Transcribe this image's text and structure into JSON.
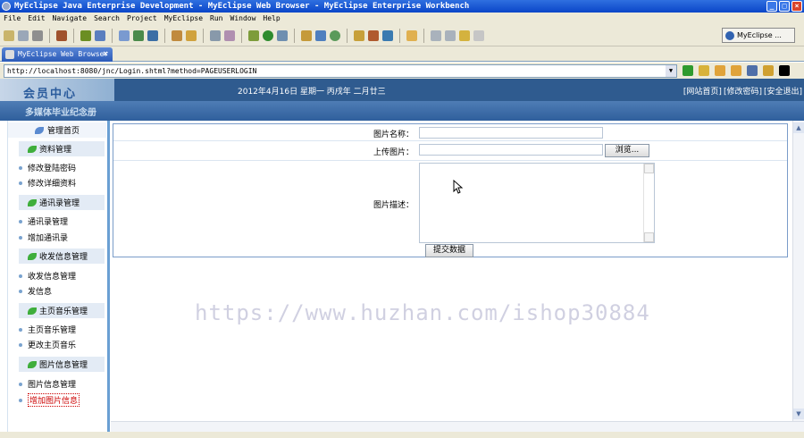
{
  "window": {
    "title": "MyEclipse Java Enterprise Development - MyEclipse Web Browser - MyEclipse Enterprise Workbench"
  },
  "menu": [
    "File",
    "Edit",
    "Navigate",
    "Search",
    "Project",
    "MyEclipse",
    "Run",
    "Window",
    "Help"
  ],
  "perspective": "MyEclipse ...",
  "tab": {
    "label": "MyEclipse Web Browser"
  },
  "address": "http://localhost:8080/jnc/Login.shtml?method=PAGEUSERLOGIN",
  "header": {
    "logo": "会员中心",
    "date": "2012年4月16日 星期一 丙戌年 二月廿三",
    "links": [
      "[网站首页]",
      "[修改密码]",
      "[安全退出]"
    ]
  },
  "subheader": {
    "title": "多媒体毕业纪念册"
  },
  "sidebar": {
    "home": "管理首页",
    "groups": [
      {
        "title": "资料管理",
        "items": [
          "修改登陆密码",
          "修改详细资料"
        ]
      },
      {
        "title": "通讯录管理",
        "items": [
          "通讯录管理",
          "增加通讯录"
        ]
      },
      {
        "title": "收发信息管理",
        "items": [
          "收发信息管理",
          "发信息"
        ]
      },
      {
        "title": "主页音乐管理",
        "items": [
          "主页音乐管理",
          "更改主页音乐"
        ]
      },
      {
        "title": "图片信息管理",
        "items": [
          "图片信息管理",
          "增加图片信息"
        ]
      }
    ]
  },
  "form": {
    "name_label": "图片名称：",
    "name_value": "",
    "upload_label": "上传图片：",
    "upload_value": "",
    "browse_label": "浏览...",
    "desc_label": "图片描述：",
    "desc_value": "",
    "submit_label": "提交数据"
  },
  "watermark": "https://www.huzhan.com/ishop30884",
  "colors": {
    "header": "#2f5b8f",
    "accent": "#6a9fd3",
    "titlebar": "#0a45c8"
  }
}
